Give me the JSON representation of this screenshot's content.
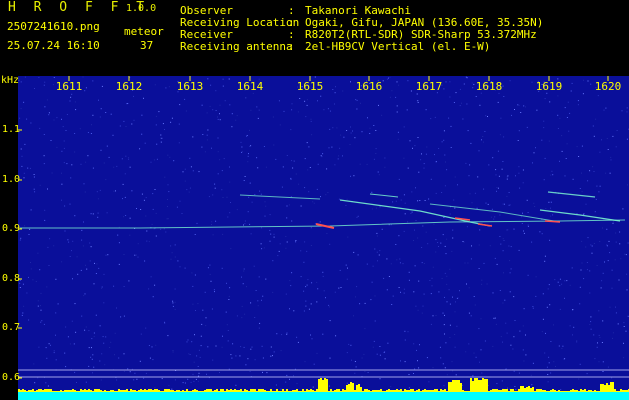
{
  "header": {
    "app_title": "H R O F F T",
    "version": "1.0.0",
    "filename": "2507241610.png",
    "datetime": "25.07.24 16:10",
    "meteor_label": "meteor",
    "meteor_count": "37",
    "info": [
      {
        "label": "Observer",
        "value": "Takanori Kawachi"
      },
      {
        "label": "Receiving Location",
        "value": "Ogaki, Gifu, JAPAN (136.60E, 35.35N)"
      },
      {
        "label": "Receiver",
        "value": "R820T2(RTL-SDR) SDR-Sharp 53.372MHz"
      },
      {
        "label": "Receiving antenna",
        "value": "2el-HB9CV Vertical (el. E-W)"
      }
    ]
  },
  "spectrogram": {
    "freq_unit": "kHz",
    "freq_labels": [
      "1.1",
      "1.0",
      "0.9",
      "0.8",
      "0.7",
      "0.6"
    ],
    "time_labels": [
      "1611",
      "1612",
      "1613",
      "1614",
      "1615",
      "1616",
      "1617",
      "1618",
      "1619",
      "1620"
    ],
    "background_color": "#0a0f9a",
    "trace_color": "#7fffd4",
    "echo_color": "#ff5050",
    "level_bar_color": "#ffff00",
    "baseline_color": "#00ffff"
  }
}
